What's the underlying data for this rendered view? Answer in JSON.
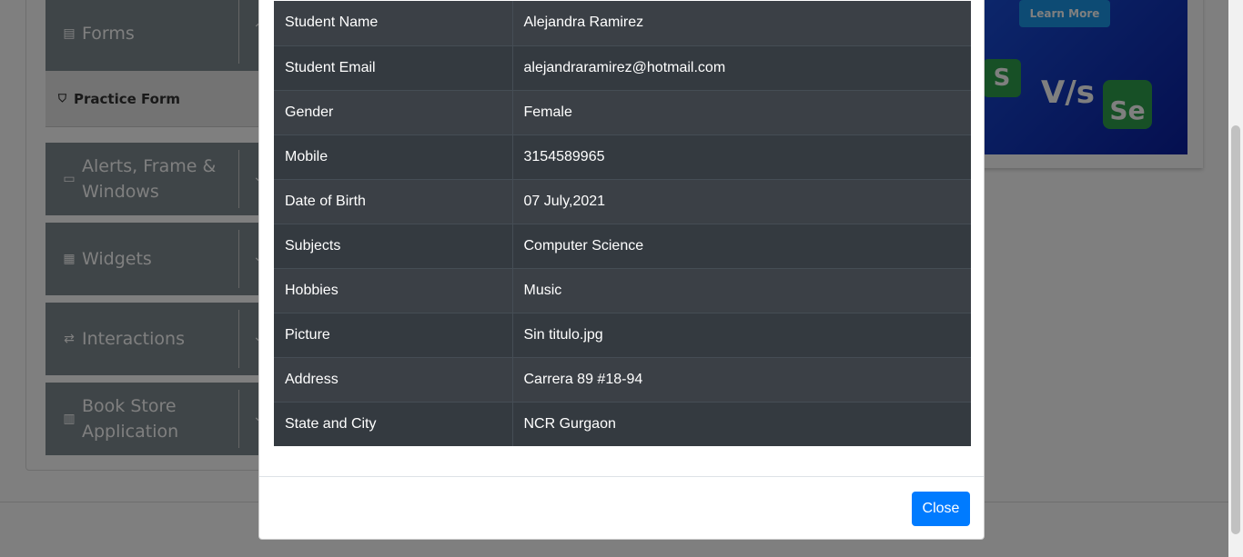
{
  "sidebar": {
    "groups": [
      {
        "label": "Forms",
        "icon": "document-icon"
      },
      {
        "label": "Alerts, Frame & Windows",
        "icon": "window-icon"
      },
      {
        "label": "Widgets",
        "icon": "widgets-icon"
      },
      {
        "label": "Interactions",
        "icon": "interactions-icon"
      },
      {
        "label": "Book Store Application",
        "icon": "books-icon"
      }
    ],
    "active_item": "Practice Form"
  },
  "banner": {
    "learn_more": "Learn More",
    "logo_left": "S",
    "vs": "V/s",
    "logo_right": "Se"
  },
  "modal": {
    "rows": [
      {
        "label": "Student Name",
        "value": "Alejandra Ramirez"
      },
      {
        "label": "Student Email",
        "value": "alejandraramirez@hotmail.com"
      },
      {
        "label": "Gender",
        "value": "Female"
      },
      {
        "label": "Mobile",
        "value": "3154589965"
      },
      {
        "label": "Date of Birth",
        "value": "07 July,2021"
      },
      {
        "label": "Subjects",
        "value": "Computer Science"
      },
      {
        "label": "Hobbies",
        "value": "Music"
      },
      {
        "label": "Picture",
        "value": "Sin titulo.jpg"
      },
      {
        "label": "Address",
        "value": "Carrera 89 #18-94"
      },
      {
        "label": "State and City",
        "value": "NCR Gurgaon"
      }
    ],
    "close_label": "Close"
  },
  "colors": {
    "primary": "#007bff",
    "table_dark": "#343a40",
    "sidebar": "#263b47"
  }
}
